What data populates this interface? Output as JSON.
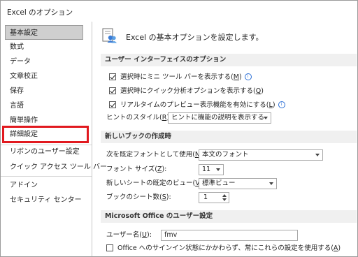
{
  "window": {
    "title": "Excel のオプション"
  },
  "sidebar": {
    "items": [
      {
        "label": "基本設定"
      },
      {
        "label": "数式"
      },
      {
        "label": "データ"
      },
      {
        "label": "文章校正"
      },
      {
        "label": "保存"
      },
      {
        "label": "言語"
      },
      {
        "label": "簡単操作"
      },
      {
        "label": "詳細設定"
      },
      {
        "label": "リボンのユーザー設定"
      },
      {
        "label": "クイック アクセス ツール バー"
      },
      {
        "label": "アドイン"
      },
      {
        "label": "セキュリティ センター"
      }
    ],
    "selected_index": 0,
    "highlight_index": 7,
    "highlight_color": "#e1191f"
  },
  "main": {
    "header": "Excel の基本オプションを設定します。",
    "ui_section": {
      "title": "ユーザー インターフェイスのオプション",
      "options": [
        {
          "label": "選択時にミニ ツール バーを表示する(",
          "key": "M",
          "suffix": ")",
          "checked": true,
          "info": true
        },
        {
          "label": "選択時にクイック分析オプションを表示する(",
          "key": "Q",
          "suffix": ")",
          "checked": true,
          "info": false
        },
        {
          "label": "リアルタイムのプレビュー表示機能を有効にする(",
          "key": "L",
          "suffix": ")",
          "checked": true,
          "info": true
        }
      ],
      "hint_style": {
        "label": "ヒントのスタイル(",
        "key": "R",
        "suffix": "):",
        "value": "ヒントに機能の説明を表示する"
      }
    },
    "new_book_section": {
      "title": "新しいブックの作成時",
      "font": {
        "label": "次を既定フォントとして使用(",
        "key": "N",
        "suffix": "):",
        "value": "本文のフォント"
      },
      "font_size": {
        "label": "フォント サイズ(",
        "key": "Z",
        "suffix": "):",
        "value": "11"
      },
      "default_view": {
        "label": "新しいシートの既定のビュー(",
        "key": "V",
        "suffix": "):",
        "value": "標準ビュー"
      },
      "sheet_count": {
        "label": "ブックのシート数(",
        "key": "S",
        "suffix": "):",
        "value": "1"
      }
    },
    "office_section": {
      "title": "Microsoft Office のユーザー設定",
      "username": {
        "label": "ユーザー名(",
        "key": "U",
        "suffix": "):",
        "value": "fmv"
      },
      "always_use": {
        "label": "Office へのサインイン状態にかかわらず、常にこれらの設定を使用する(",
        "key": "A",
        "suffix": ")",
        "checked": false
      }
    }
  },
  "icons": {
    "header": "options-icon",
    "info": "info-icon"
  }
}
